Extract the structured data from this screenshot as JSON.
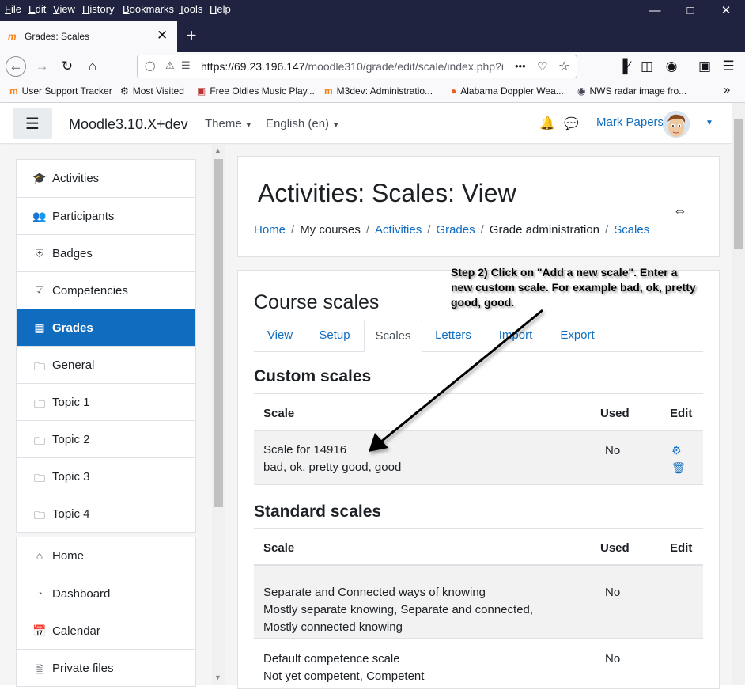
{
  "menubar": {
    "items": [
      "File",
      "Edit",
      "View",
      "History",
      "Bookmarks",
      "Tools",
      "Help"
    ]
  },
  "tab": {
    "title": "Grades: Scales",
    "close_glyph": "✕",
    "new_glyph": "+"
  },
  "url": {
    "text_host": "https://69.23.196.147",
    "text_path": "/moodle310/grade/edit/scale/index.php?i",
    "more_glyph": "•••"
  },
  "bookmarks": [
    "User Support Tracker",
    "Most Visited",
    "Free Oldies Music Play...",
    "M3dev: Administratio...",
    "Alabama Doppler Wea...",
    "NWS radar image fro..."
  ],
  "moodle_nav": {
    "brand": "Moodle3.10.X+dev",
    "theme": "Theme",
    "language": "English (en)",
    "user": "Mark Papers"
  },
  "drawer": {
    "course": [
      {
        "label": "Activities",
        "icon": "graduation-cap-icon"
      },
      {
        "label": "Participants",
        "icon": "users-icon"
      },
      {
        "label": "Badges",
        "icon": "shield-icon"
      },
      {
        "label": "Competencies",
        "icon": "checkbox-icon"
      },
      {
        "label": "Grades",
        "icon": "table-icon",
        "active": true
      },
      {
        "label": "General",
        "icon": "folder-icon"
      },
      {
        "label": "Topic 1",
        "icon": "folder-icon"
      },
      {
        "label": "Topic 2",
        "icon": "folder-icon"
      },
      {
        "label": "Topic 3",
        "icon": "folder-icon"
      },
      {
        "label": "Topic 4",
        "icon": "folder-icon"
      }
    ],
    "site": [
      {
        "label": "Home",
        "icon": "home-icon"
      },
      {
        "label": "Dashboard",
        "icon": "dashboard-icon"
      },
      {
        "label": "Calendar",
        "icon": "calendar-icon"
      },
      {
        "label": "Private files",
        "icon": "file-icon"
      }
    ]
  },
  "header": {
    "title": "Activities: Scales: View",
    "breadcrumb": [
      {
        "label": "Home",
        "link": true
      },
      {
        "label": "My courses",
        "link": false
      },
      {
        "label": "Activities",
        "link": true
      },
      {
        "label": "Grades",
        "link": true
      },
      {
        "label": "Grade administration",
        "link": false
      },
      {
        "label": "Scales",
        "link": true
      }
    ]
  },
  "main": {
    "heading": "Course scales",
    "tabs": [
      "View",
      "Setup",
      "Scales",
      "Letters",
      "Import",
      "Export"
    ],
    "active_tab": "Scales",
    "custom": {
      "heading": "Custom scales",
      "columns": [
        "Scale",
        "Used",
        "Edit"
      ],
      "rows": [
        {
          "name": "Scale for 14916",
          "items": "bad, ok, pretty good, good",
          "used": "No"
        }
      ]
    },
    "standard": {
      "heading": "Standard scales",
      "columns": [
        "Scale",
        "Used",
        "Edit"
      ],
      "rows": [
        {
          "name": "Separate and Connected ways of knowing",
          "items1": "Mostly separate knowing, Separate and connected,",
          "items2": "Mostly connected knowing",
          "used": "No"
        },
        {
          "name": "Default competence scale",
          "items1": "Not yet competent, Competent",
          "used": "No"
        }
      ]
    }
  },
  "annotation": {
    "line1": "Step  2) Click on \"Add a new scale\". Enter a",
    "line2": "new custom scale. For example bad, ok, pretty",
    "line3": "good, good."
  }
}
